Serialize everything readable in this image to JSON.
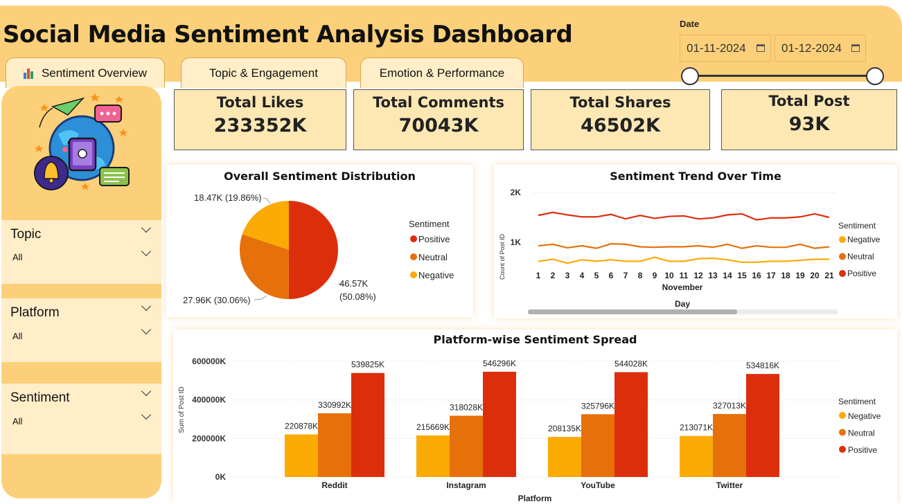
{
  "header": {
    "title": "Social Media Sentiment Analysis Dashboard",
    "tabs": [
      {
        "label": "Sentiment Overview",
        "icon": "bar-chart-icon"
      },
      {
        "label": "Topic & Engagement"
      },
      {
        "label": "Emotion & Performance"
      }
    ],
    "date": {
      "label": "Date",
      "start": "01-11-2024",
      "end": "01-12-2024"
    }
  },
  "sidebar": {
    "illustration": "social-media-globe-illustration",
    "filters": [
      {
        "title": "Topic",
        "value": "All"
      },
      {
        "title": "Platform",
        "value": "All"
      },
      {
        "title": "Sentiment",
        "value": "All"
      }
    ]
  },
  "kpis": [
    {
      "label": "Total Likes",
      "value": "233352K"
    },
    {
      "label": "Total Comments",
      "value": "70043K"
    },
    {
      "label": "Total Shares",
      "value": "46502K"
    },
    {
      "label": "Total Post",
      "value": "93K"
    }
  ],
  "colors": {
    "Positive": "#dd2e0c",
    "Neutral": "#e6700a",
    "Negative": "#fbab04",
    "background": "#fcd07a",
    "card": "#fde8b4"
  },
  "charts": {
    "pie_title": "Overall Sentiment Distribution",
    "trend_title": "Sentiment Trend Over Time",
    "bar_title": "Platform-wise Sentiment Spread"
  },
  "chart_data": [
    {
      "type": "pie",
      "title": "Overall Sentiment Distribution",
      "legend_title": "Sentiment",
      "legend_position": "right",
      "slices": [
        {
          "name": "Positive",
          "value": 46.57,
          "label": "46.57K (50.08%)"
        },
        {
          "name": "Neutral",
          "value": 27.96,
          "label": "27.96K (30.06%)"
        },
        {
          "name": "Negative",
          "value": 18.47,
          "label": "18.47K (19.86%)"
        }
      ]
    },
    {
      "type": "line",
      "title": "Sentiment Trend Over Time",
      "xlabel": "Day",
      "xsublabel": "November",
      "ylabel": "Count of Post ID",
      "yticks": [
        "1K",
        "2K"
      ],
      "ylim": [
        0,
        2000
      ],
      "legend_title": "Sentiment",
      "legend_order": [
        "Negative",
        "Neutral",
        "Positive"
      ],
      "x": [
        1,
        2,
        3,
        4,
        5,
        6,
        7,
        8,
        9,
        10,
        11,
        12,
        13,
        14,
        15,
        16,
        17,
        18,
        19,
        20,
        21
      ],
      "series": [
        {
          "name": "Positive",
          "values": [
            1540,
            1600,
            1550,
            1510,
            1510,
            1560,
            1470,
            1540,
            1480,
            1520,
            1530,
            1470,
            1490,
            1550,
            1570,
            1450,
            1490,
            1490,
            1510,
            1570,
            1500
          ]
        },
        {
          "name": "Neutral",
          "values": [
            930,
            960,
            890,
            930,
            880,
            970,
            960,
            910,
            900,
            910,
            910,
            930,
            900,
            960,
            880,
            930,
            900,
            900,
            960,
            880,
            910
          ]
        },
        {
          "name": "Negative",
          "values": [
            620,
            660,
            580,
            650,
            620,
            650,
            620,
            620,
            700,
            620,
            620,
            670,
            680,
            650,
            600,
            600,
            620,
            620,
            640,
            660,
            660
          ]
        }
      ]
    },
    {
      "type": "bar",
      "title": "Platform-wise Sentiment Spread",
      "xlabel": "Platform",
      "ylabel": "Sum of Post ID",
      "yticks": [
        "0K",
        "200000K",
        "400000K",
        "600000K"
      ],
      "ylim": [
        0,
        600000
      ],
      "legend_title": "Sentiment",
      "categories": [
        "Reddit",
        "Instagram",
        "YouTube",
        "Twitter"
      ],
      "series": [
        {
          "name": "Negative",
          "values": [
            220878,
            215669,
            208135,
            213071
          ],
          "labels": [
            "220878K",
            "215669K",
            "208135K",
            "213071K"
          ]
        },
        {
          "name": "Neutral",
          "values": [
            330992,
            318028,
            325796,
            327013
          ],
          "labels": [
            "330992K",
            "318028K",
            "325796K",
            "327013K"
          ]
        },
        {
          "name": "Positive",
          "values": [
            539825,
            546296,
            544028,
            534816
          ],
          "labels": [
            "539825K",
            "546296K",
            "544028K",
            "534816K"
          ]
        }
      ]
    }
  ]
}
